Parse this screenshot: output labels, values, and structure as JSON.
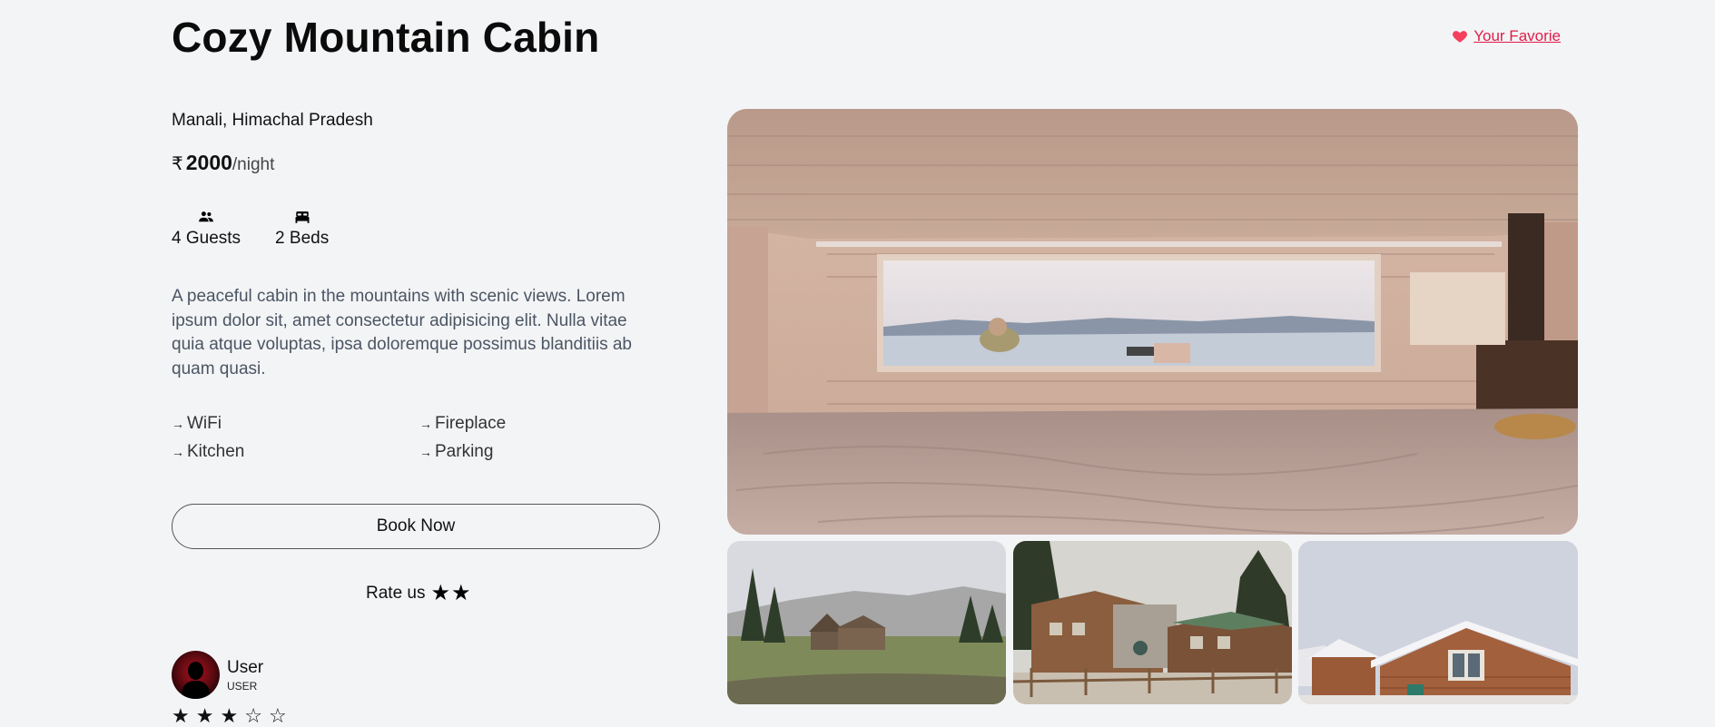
{
  "listing": {
    "title": "Cozy Mountain Cabin",
    "location": "Manali, Himachal Pradesh",
    "currency_symbol": "₹",
    "price": "2000",
    "price_unit": "/night",
    "guests": "4 Guests",
    "beds": "2 Beds",
    "description": "A peaceful cabin in the mountains with scenic views. Lorem ipsum dolor sit, amet consectetur adipisicing elit. Nulla vitae quia atque voluptas, ipsa doloremque possimus blanditiis ab quam quasi.",
    "amenities": [
      "WiFi",
      "Fireplace",
      "Kitchen",
      "Parking"
    ]
  },
  "favorite": {
    "label": "Your Favorie",
    "icon": "heart-icon",
    "color": "#e11d48"
  },
  "actions": {
    "book_label": "Book Now"
  },
  "rating": {
    "label": "Rate us",
    "stars_shown": 2,
    "star_glyph": "★"
  },
  "review": {
    "user_name": "User",
    "user_role": "USER",
    "stars": [
      "★",
      "★",
      "★",
      "☆",
      "☆"
    ],
    "rating_value": 3,
    "rating_max": 5
  },
  "icons": {
    "guests": "users-icon",
    "beds": "bed-icon",
    "amenity_bullet": "arrow-right-icon"
  },
  "amenity_arrow": "→"
}
